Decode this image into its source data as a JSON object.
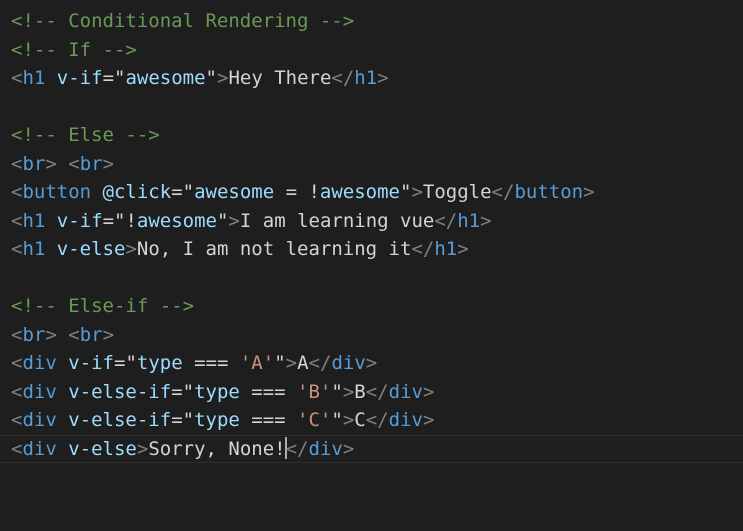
{
  "editor": {
    "language": "html",
    "colors": {
      "background": "#1e1e1e",
      "comment": "#6a9955",
      "punctuation": "#808080",
      "tag": "#569cd6",
      "attribute": "#9cdcfe",
      "text": "#d4d4d4",
      "string_single": "#ce9178"
    },
    "cursor": {
      "line": 16,
      "after_text": "Sorry, None!"
    },
    "lines": [
      [
        {
          "t": "comment",
          "v": "<!-- Conditional Rendering -->"
        }
      ],
      [
        {
          "t": "comment",
          "v": "<!-- If -->"
        }
      ],
      [
        {
          "t": "punct",
          "v": "<"
        },
        {
          "t": "tag",
          "v": "h1"
        },
        {
          "t": "text",
          "v": " "
        },
        {
          "t": "attr",
          "v": "v-if"
        },
        {
          "t": "text",
          "v": "=\""
        },
        {
          "t": "attr",
          "v": "awesome"
        },
        {
          "t": "text",
          "v": "\""
        },
        {
          "t": "punct",
          "v": ">"
        },
        {
          "t": "text",
          "v": "Hey There"
        },
        {
          "t": "punct",
          "v": "</"
        },
        {
          "t": "tag",
          "v": "h1"
        },
        {
          "t": "punct",
          "v": ">"
        }
      ],
      [],
      [
        {
          "t": "comment",
          "v": "<!-- Else -->"
        }
      ],
      [
        {
          "t": "punct",
          "v": "<"
        },
        {
          "t": "tag",
          "v": "br"
        },
        {
          "t": "punct",
          "v": ">"
        },
        {
          "t": "text",
          "v": " "
        },
        {
          "t": "punct",
          "v": "<"
        },
        {
          "t": "tag",
          "v": "br"
        },
        {
          "t": "punct",
          "v": ">"
        }
      ],
      [
        {
          "t": "punct",
          "v": "<"
        },
        {
          "t": "tag",
          "v": "button"
        },
        {
          "t": "text",
          "v": " "
        },
        {
          "t": "attr",
          "v": "@click"
        },
        {
          "t": "text",
          "v": "=\""
        },
        {
          "t": "attr",
          "v": "awesome"
        },
        {
          "t": "text",
          "v": " = !"
        },
        {
          "t": "attr",
          "v": "awesome"
        },
        {
          "t": "text",
          "v": "\""
        },
        {
          "t": "punct",
          "v": ">"
        },
        {
          "t": "text",
          "v": "Toggle"
        },
        {
          "t": "punct",
          "v": "</"
        },
        {
          "t": "tag",
          "v": "button"
        },
        {
          "t": "punct",
          "v": ">"
        }
      ],
      [
        {
          "t": "punct",
          "v": "<"
        },
        {
          "t": "tag",
          "v": "h1"
        },
        {
          "t": "text",
          "v": " "
        },
        {
          "t": "attr",
          "v": "v-if"
        },
        {
          "t": "text",
          "v": "=\"!"
        },
        {
          "t": "attr",
          "v": "awesome"
        },
        {
          "t": "text",
          "v": "\""
        },
        {
          "t": "punct",
          "v": ">"
        },
        {
          "t": "text",
          "v": "I am learning vue"
        },
        {
          "t": "punct",
          "v": "</"
        },
        {
          "t": "tag",
          "v": "h1"
        },
        {
          "t": "punct",
          "v": ">"
        }
      ],
      [
        {
          "t": "punct",
          "v": "<"
        },
        {
          "t": "tag",
          "v": "h1"
        },
        {
          "t": "text",
          "v": " "
        },
        {
          "t": "attr",
          "v": "v-else"
        },
        {
          "t": "punct",
          "v": ">"
        },
        {
          "t": "text",
          "v": "No, I am not learning it"
        },
        {
          "t": "punct",
          "v": "</"
        },
        {
          "t": "tag",
          "v": "h1"
        },
        {
          "t": "punct",
          "v": ">"
        }
      ],
      [],
      [
        {
          "t": "comment",
          "v": "<!-- Else-if -->"
        }
      ],
      [
        {
          "t": "punct",
          "v": "<"
        },
        {
          "t": "tag",
          "v": "br"
        },
        {
          "t": "punct",
          "v": ">"
        },
        {
          "t": "text",
          "v": " "
        },
        {
          "t": "punct",
          "v": "<"
        },
        {
          "t": "tag",
          "v": "br"
        },
        {
          "t": "punct",
          "v": ">"
        }
      ],
      [
        {
          "t": "punct",
          "v": "<"
        },
        {
          "t": "tag",
          "v": "div"
        },
        {
          "t": "text",
          "v": " "
        },
        {
          "t": "attr",
          "v": "v-if"
        },
        {
          "t": "text",
          "v": "=\""
        },
        {
          "t": "attr",
          "v": "type"
        },
        {
          "t": "text",
          "v": " === "
        },
        {
          "t": "squote",
          "v": "'A'"
        },
        {
          "t": "text",
          "v": "\""
        },
        {
          "t": "punct",
          "v": ">"
        },
        {
          "t": "text",
          "v": "A"
        },
        {
          "t": "punct",
          "v": "</"
        },
        {
          "t": "tag",
          "v": "div"
        },
        {
          "t": "punct",
          "v": ">"
        }
      ],
      [
        {
          "t": "punct",
          "v": "<"
        },
        {
          "t": "tag",
          "v": "div"
        },
        {
          "t": "text",
          "v": " "
        },
        {
          "t": "attr",
          "v": "v-else-if"
        },
        {
          "t": "text",
          "v": "=\""
        },
        {
          "t": "attr",
          "v": "type"
        },
        {
          "t": "text",
          "v": " === "
        },
        {
          "t": "squote",
          "v": "'B'"
        },
        {
          "t": "text",
          "v": "\""
        },
        {
          "t": "punct",
          "v": ">"
        },
        {
          "t": "text",
          "v": "B"
        },
        {
          "t": "punct",
          "v": "</"
        },
        {
          "t": "tag",
          "v": "div"
        },
        {
          "t": "punct",
          "v": ">"
        }
      ],
      [
        {
          "t": "punct",
          "v": "<"
        },
        {
          "t": "tag",
          "v": "div"
        },
        {
          "t": "text",
          "v": " "
        },
        {
          "t": "attr",
          "v": "v-else-if"
        },
        {
          "t": "text",
          "v": "=\""
        },
        {
          "t": "attr",
          "v": "type"
        },
        {
          "t": "text",
          "v": " === "
        },
        {
          "t": "squote",
          "v": "'C'"
        },
        {
          "t": "text",
          "v": "\""
        },
        {
          "t": "punct",
          "v": ">"
        },
        {
          "t": "text",
          "v": "C"
        },
        {
          "t": "punct",
          "v": "</"
        },
        {
          "t": "tag",
          "v": "div"
        },
        {
          "t": "punct",
          "v": ">"
        }
      ],
      [
        {
          "t": "punct",
          "v": "<"
        },
        {
          "t": "tag",
          "v": "div"
        },
        {
          "t": "text",
          "v": " "
        },
        {
          "t": "attr",
          "v": "v-else"
        },
        {
          "t": "punct",
          "v": ">"
        },
        {
          "t": "text",
          "v": "Sorry, None!"
        },
        {
          "t": "punct",
          "v": "</"
        },
        {
          "t": "tag",
          "v": "div"
        },
        {
          "t": "punct",
          "v": ">"
        }
      ]
    ]
  }
}
